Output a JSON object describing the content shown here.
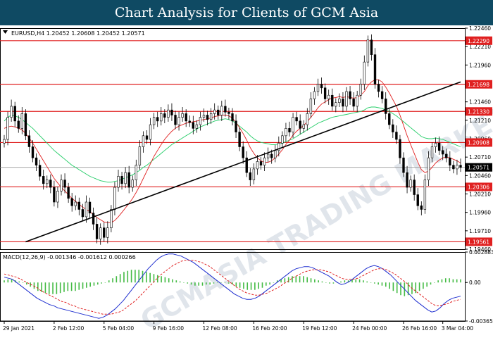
{
  "header": {
    "title": "Chart Analysis for Clients of GCM Asia"
  },
  "chart_data": [
    {
      "type": "candlestick",
      "symbol_line": "EURUSD,H4  1.20452 1.20608 1.20452 1.20571",
      "ylim": [
        1.1946,
        1.2246
      ],
      "y_ticks": [
        "1.22460",
        "1.22210",
        "1.21960",
        "1.21710",
        "1.21460",
        "1.21210",
        "1.20960",
        "1.20710",
        "1.20460",
        "1.20210",
        "1.19960",
        "1.19710",
        "1.19460"
      ],
      "x_labels": [
        "29 Jan 2021",
        "2 Feb 12:00",
        "5 Feb 04:00",
        "9 Feb 16:00",
        "12 Feb 08:00",
        "16 Feb 20:00",
        "19 Feb 12:00",
        "24 Feb 00:00",
        "26 Feb 16:00",
        "3 Mar 04:00"
      ],
      "horizontal_levels": [
        {
          "value": 1.2229,
          "label": "1.22290",
          "color": "#e02020"
        },
        {
          "value": 1.21698,
          "label": "1.21698",
          "color": "#e02020"
        },
        {
          "value": 1.2133,
          "label": "1.21330",
          "color": "#e02020"
        },
        {
          "value": 1.20908,
          "label": "1.20908",
          "color": "#e02020"
        },
        {
          "value": 1.20306,
          "label": "1.20306",
          "color": "#e02020"
        },
        {
          "value": 1.19561,
          "label": "1.19561",
          "color": "#e02020"
        }
      ],
      "current_price": {
        "value": 1.20571,
        "label": "1.20571"
      },
      "trendline": {
        "from": [
          6,
          1.1956
        ],
        "to": [
          128,
          1.2173
        ]
      },
      "closes": [
        1.2095,
        1.2125,
        1.214,
        1.212,
        1.211,
        1.213,
        1.21,
        1.2085,
        1.207,
        1.206,
        1.2045,
        1.2035,
        1.204,
        1.203,
        1.201,
        1.2025,
        1.204,
        1.203,
        1.2015,
        1.2005,
        1.201,
        1.2,
        1.199,
        1.201,
        1.1995,
        1.198,
        1.196,
        1.1975,
        1.1962,
        1.1975,
        1.2,
        1.203,
        1.2045,
        1.2035,
        1.205,
        1.203,
        1.204,
        1.206,
        1.2085,
        1.21,
        1.2095,
        1.2115,
        1.2125,
        1.212,
        1.213,
        1.2125,
        1.2135,
        1.2128,
        1.2115,
        1.2125,
        1.213,
        1.212,
        1.2118,
        1.211,
        1.2115,
        1.2125,
        1.2128,
        1.2122,
        1.213,
        1.2135,
        1.2128,
        1.214,
        1.2132,
        1.213,
        1.212,
        1.2105,
        1.2085,
        1.207,
        1.205,
        1.204,
        1.2055,
        1.2065,
        1.206,
        1.207,
        1.2075,
        1.207,
        1.208,
        1.209,
        1.21,
        1.211,
        1.2105,
        1.2125,
        1.212,
        1.211,
        1.2115,
        1.213,
        1.215,
        1.216,
        1.217,
        1.2165,
        1.215,
        1.2155,
        1.214,
        1.2145,
        1.215,
        1.214,
        1.216,
        1.215,
        1.214,
        1.2155,
        1.217,
        1.22,
        1.223,
        1.221,
        1.217,
        1.216,
        1.215,
        1.213,
        1.2115,
        1.2105,
        1.2095,
        1.207,
        1.205,
        1.203,
        1.204,
        1.202,
        1.2005,
        1.2,
        1.204,
        1.207,
        1.2085,
        1.209,
        1.208,
        1.2075,
        1.207,
        1.206,
        1.2055,
        1.206,
        1.2057
      ],
      "ma_green": [
        1.212,
        1.2125,
        1.2128,
        1.2127,
        1.2125,
        1.2122,
        1.2118,
        1.2114,
        1.211,
        1.2105,
        1.21,
        1.2095,
        1.209,
        1.2085,
        1.208,
        1.2076,
        1.2072,
        1.2068,
        1.2064,
        1.206,
        1.2057,
        1.2054,
        1.2051,
        1.2048,
        1.2045,
        1.2043,
        1.2041,
        1.2039,
        1.2038,
        1.2037,
        1.2037,
        1.2038,
        1.2039,
        1.2041,
        1.2043,
        1.2045,
        1.2047,
        1.205,
        1.2053,
        1.2057,
        1.206,
        1.2064,
        1.2068,
        1.2072,
        1.2076,
        1.208,
        1.2084,
        1.2088,
        1.2091,
        1.2094,
        1.2097,
        1.21,
        1.2103,
        1.2106,
        1.2109,
        1.2112,
        1.2114,
        1.2116,
        1.2118,
        1.212,
        1.2121,
        1.2122,
        1.2123,
        1.2122,
        1.212,
        1.2117,
        1.2113,
        1.2109,
        1.2105,
        1.21,
        1.2096,
        1.2093,
        1.2091,
        1.209,
        1.2089,
        1.2088,
        1.2088,
        1.2089,
        1.209,
        1.2092,
        1.2094,
        1.2096,
        1.2099,
        1.2102,
        1.2105,
        1.2108,
        1.2111,
        1.2114,
        1.2117,
        1.2119,
        1.2121,
        1.2123,
        1.2125,
        1.2126,
        1.2127,
        1.2128,
        1.2129,
        1.213,
        1.2131,
        1.2132,
        1.2133,
        1.2135,
        1.2138,
        1.2139,
        1.2139,
        1.2138,
        1.2137,
        1.2135,
        1.2133,
        1.213,
        1.2127,
        1.2123,
        1.2119,
        1.2115,
        1.2111,
        1.2107,
        1.2103,
        1.2099,
        1.2097,
        1.2096,
        1.2096,
        1.2097,
        1.2096,
        1.2095,
        1.2093,
        1.2091,
        1.2089,
        1.2087,
        1.2085
      ],
      "ma_red": [
        1.211,
        1.2112,
        1.2113,
        1.2112,
        1.211,
        1.2108,
        1.2103,
        1.2097,
        1.209,
        1.2082,
        1.2074,
        1.2066,
        1.2058,
        1.205,
        1.2042,
        1.2036,
        1.203,
        1.2025,
        1.202,
        1.2015,
        1.2011,
        1.2007,
        1.2003,
        1.2,
        1.1997,
        1.1993,
        1.1989,
        1.1986,
        1.1983,
        1.1982,
        1.1982,
        1.1985,
        1.199,
        1.1996,
        1.2002,
        1.2008,
        1.2015,
        1.2023,
        1.2032,
        1.2042,
        1.2052,
        1.2062,
        1.2072,
        1.208,
        1.2088,
        1.2095,
        1.2101,
        1.2106,
        1.211,
        1.2113,
        1.2115,
        1.2117,
        1.2118,
        1.2119,
        1.212,
        1.2121,
        1.2122,
        1.2123,
        1.2124,
        1.2126,
        1.2127,
        1.2128,
        1.2128,
        1.2127,
        1.2124,
        1.2118,
        1.2111,
        1.2103,
        1.2094,
        1.2084,
        1.2076,
        1.207,
        1.2066,
        1.2064,
        1.2064,
        1.2066,
        1.207,
        1.2075,
        1.2081,
        1.2088,
        1.2094,
        1.2101,
        1.2106,
        1.211,
        1.2114,
        1.2119,
        1.2125,
        1.2131,
        1.2138,
        1.2143,
        1.2146,
        1.2149,
        1.2151,
        1.2152,
        1.2153,
        1.2152,
        1.2153,
        1.2152,
        1.2151,
        1.2152,
        1.2155,
        1.216,
        1.2168,
        1.2173,
        1.2176,
        1.2176,
        1.2173,
        1.2166,
        1.2158,
        1.2149,
        1.214,
        1.2128,
        1.2114,
        1.21,
        1.2088,
        1.2076,
        1.2064,
        1.2054,
        1.205,
        1.2052,
        1.2057,
        1.2063,
        1.2067,
        1.207,
        1.2071,
        1.207,
        1.2068,
        1.2066,
        1.2063
      ]
    },
    {
      "type": "macd",
      "header": "MACD(12,26,9) -0.001346 -0.001612 0.000266",
      "ylim": [
        -0.003652,
        0.002883
      ],
      "y_ticks": [
        "0.002883",
        "0.00",
        "-0.003652"
      ],
      "histogram": [
        0.0002,
        0.0003,
        0.0003,
        0.0002,
        0.0001,
        0.0,
        -0.0002,
        -0.0004,
        -0.0006,
        -0.0008,
        -0.0009,
        -0.001,
        -0.0011,
        -0.0011,
        -0.0011,
        -0.001,
        -0.0009,
        -0.0008,
        -0.0008,
        -0.0008,
        -0.0007,
        -0.0006,
        -0.0005,
        -0.0004,
        -0.0003,
        -0.0002,
        -0.0001,
        0.0,
        0.0002,
        0.0004,
        0.0006,
        0.0008,
        0.001,
        0.0011,
        0.0012,
        0.0012,
        0.0012,
        0.0011,
        0.001,
        0.0009,
        0.0008,
        0.0007,
        0.0006,
        0.0005,
        0.0004,
        0.0003,
        0.0002,
        0.0001,
        0.0,
        -0.0001,
        -0.0002,
        -0.0003,
        -0.0003,
        -0.0003,
        -0.0002,
        -0.0002,
        -0.0001,
        0.0,
        0.0,
        0.0,
        -0.0001,
        -0.0002,
        -0.0004,
        -0.0005,
        -0.0006,
        -0.0007,
        -0.0007,
        -0.0007,
        -0.0006,
        -0.0005,
        -0.0003,
        -0.0002,
        0.0,
        0.0002,
        0.0003,
        0.0004,
        0.0005,
        0.0006,
        0.0006,
        0.0006,
        0.0006,
        0.0005,
        0.0004,
        0.0003,
        0.0002,
        0.0001,
        0.0,
        -0.0001,
        -0.0001,
        0.0,
        0.0001,
        0.0002,
        0.0002,
        0.0003,
        0.0003,
        0.0003,
        0.0002,
        0.0001,
        0.0,
        -0.0001,
        -0.0002,
        -0.0003,
        -0.0004,
        -0.0006,
        -0.0008,
        -0.001,
        -0.0012,
        -0.0013,
        -0.0012,
        -0.0011,
        -0.001,
        -0.0008,
        -0.0006,
        -0.0004,
        -0.0002,
        0.0,
        0.0002,
        0.0003,
        0.0004,
        0.0004,
        0.0003,
        0.0003,
        0.0003
      ],
      "macd_line": [
        0.0005,
        0.0004,
        0.0003,
        0.0,
        -0.0003,
        -0.0006,
        -0.0009,
        -0.0012,
        -0.0015,
        -0.0017,
        -0.0019,
        -0.0021,
        -0.0022,
        -0.0024,
        -0.0025,
        -0.0026,
        -0.0027,
        -0.0028,
        -0.0029,
        -0.003,
        -0.0031,
        -0.0032,
        -0.0033,
        -0.0034,
        -0.0033,
        -0.0031,
        -0.0028,
        -0.0025,
        -0.0021,
        -0.0017,
        -0.0012,
        -0.0007,
        -0.0002,
        0.0003,
        0.0008,
        0.0013,
        0.0017,
        0.0021,
        0.0024,
        0.0026,
        0.0027,
        0.0027,
        0.0026,
        0.0025,
        0.0023,
        0.0021,
        0.0019,
        0.0016,
        0.0013,
        0.001,
        0.0007,
        0.0004,
        0.0001,
        -0.0002,
        -0.0005,
        -0.0008,
        -0.0011,
        -0.0013,
        -0.0015,
        -0.0016,
        -0.0016,
        -0.0015,
        -0.0013,
        -0.001,
        -0.0007,
        -0.0004,
        -0.0001,
        0.0002,
        0.0005,
        0.0008,
        0.0011,
        0.0013,
        0.0014,
        0.0015,
        0.0015,
        0.0014,
        0.0012,
        0.001,
        0.0008,
        0.0006,
        0.0003,
        0.0,
        -0.0002,
        -0.0001,
        0.0001,
        0.0004,
        0.0007,
        0.001,
        0.0013,
        0.0015,
        0.0016,
        0.0015,
        0.0013,
        0.001,
        0.0007,
        0.0003,
        -0.0001,
        -0.0005,
        -0.0009,
        -0.0013,
        -0.0017,
        -0.002,
        -0.0023,
        -0.0026,
        -0.0028,
        -0.0027,
        -0.0024,
        -0.002,
        -0.0017,
        -0.0015,
        -0.0014,
        -0.0013
      ],
      "signal_line": [
        0.0008,
        0.0007,
        0.0006,
        0.0005,
        0.0003,
        0.0001,
        -0.0001,
        -0.0003,
        -0.0005,
        -0.0008,
        -0.001,
        -0.0012,
        -0.0014,
        -0.0016,
        -0.0018,
        -0.0019,
        -0.0021,
        -0.0022,
        -0.0024,
        -0.0025,
        -0.0026,
        -0.0027,
        -0.0028,
        -0.0029,
        -0.003,
        -0.003,
        -0.003,
        -0.0029,
        -0.0028,
        -0.0026,
        -0.0023,
        -0.002,
        -0.0017,
        -0.0013,
        -0.0009,
        -0.0005,
        -0.0001,
        0.0003,
        0.0007,
        0.001,
        0.0013,
        0.0016,
        0.0018,
        0.002,
        0.0021,
        0.0021,
        0.0021,
        0.002,
        0.0019,
        0.0017,
        0.0015,
        0.0012,
        0.0009,
        0.0006,
        0.0003,
        0.0,
        -0.0003,
        -0.0006,
        -0.0008,
        -0.001,
        -0.0011,
        -0.0012,
        -0.0012,
        -0.0011,
        -0.001,
        -0.0008,
        -0.0006,
        -0.0004,
        -0.0001,
        0.0001,
        0.0004,
        0.0006,
        0.0008,
        0.001,
        0.0011,
        0.0012,
        0.0012,
        0.0012,
        0.0011,
        0.001,
        0.0008,
        0.0006,
        0.0004,
        0.0003,
        0.0003,
        0.0003,
        0.0004,
        0.0006,
        0.0008,
        0.001,
        0.0012,
        0.0013,
        0.0013,
        0.0012,
        0.001,
        0.0008,
        0.0005,
        0.0002,
        -0.0001,
        -0.0005,
        -0.0008,
        -0.0011,
        -0.0014,
        -0.0017,
        -0.002,
        -0.0022,
        -0.0022,
        -0.0021,
        -0.002,
        -0.0018,
        -0.0017,
        -0.0016
      ]
    }
  ],
  "watermark": "GCMASIA TRADING MARKETS",
  "colors": {
    "title_bg": "#0f4a63",
    "level": "#e02020",
    "ma_green": "#22cc66",
    "ma_red": "#e02020",
    "macd_hist": "#44bb44",
    "macd_line": "#2030d0",
    "signal_line": "#e02020"
  }
}
